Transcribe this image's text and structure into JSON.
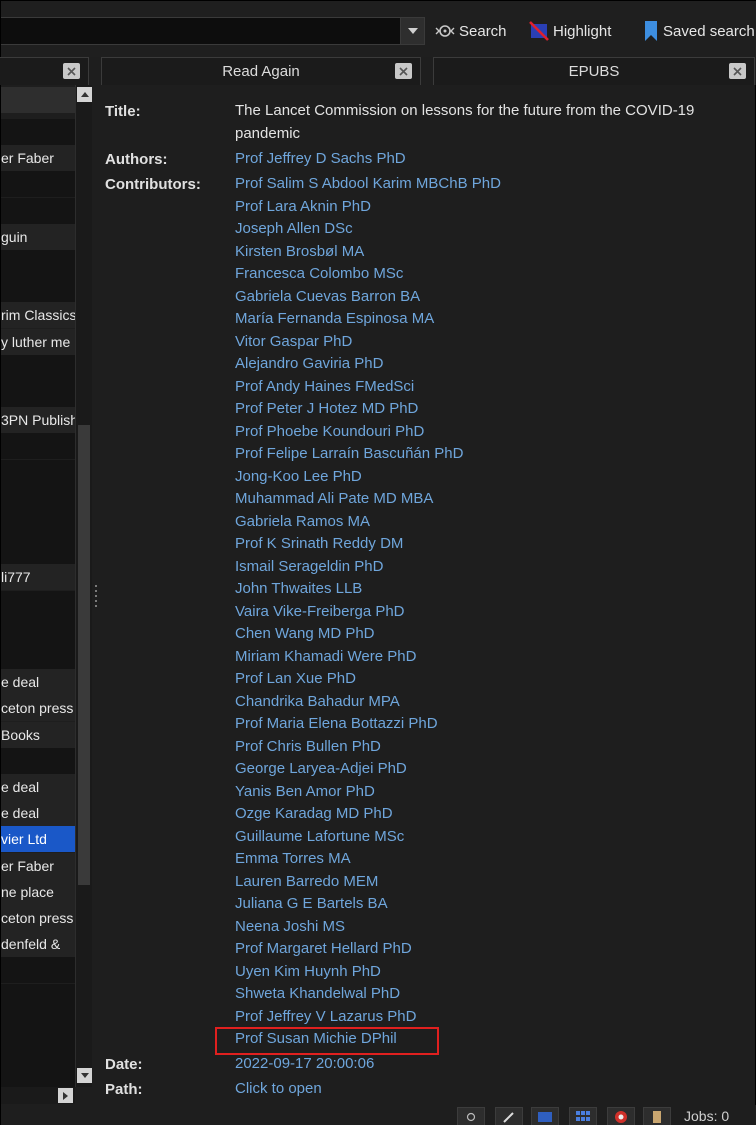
{
  "toolbar": {
    "search_label": "Search",
    "highlight_label": "Highlight",
    "saved_search_label": "Saved search"
  },
  "tabs": [
    {
      "label": ""
    },
    {
      "label": "Read Again"
    },
    {
      "label": "EPUBS"
    }
  ],
  "left_list": {
    "rows": [
      {
        "text": "",
        "style": "dark"
      },
      {
        "text": "er  Faber",
        "style": "mid"
      },
      {
        "text": "",
        "style": "dark"
      },
      {
        "text": "",
        "style": "dark"
      },
      {
        "text": "guin",
        "style": "mid"
      },
      {
        "text": "",
        "style": "dark"
      },
      {
        "text": "",
        "style": "dark"
      },
      {
        "text": "rim Classics",
        "style": "mid"
      },
      {
        "text": "y luther me",
        "style": "mid"
      },
      {
        "text": "",
        "style": "dark"
      },
      {
        "text": "",
        "style": "dark"
      },
      {
        "text": "3PN Publish",
        "style": "mid"
      },
      {
        "text": "",
        "style": "dark"
      },
      {
        "text": "",
        "style": "dark"
      },
      {
        "text": "",
        "style": "dark"
      },
      {
        "text": "",
        "style": "dark"
      },
      {
        "text": "",
        "style": "dark"
      },
      {
        "text": "li777",
        "style": "mid"
      },
      {
        "text": "",
        "style": "dark"
      },
      {
        "text": "",
        "style": "dark"
      },
      {
        "text": "",
        "style": "dark"
      },
      {
        "text": "e deal",
        "style": "mid"
      },
      {
        "text": "ceton press",
        "style": "mid"
      },
      {
        "text": "Books",
        "style": "mid"
      },
      {
        "text": "",
        "style": "dark"
      },
      {
        "text": "e deal",
        "style": "mid"
      },
      {
        "text": "e deal",
        "style": "mid"
      },
      {
        "text": "vier Ltd",
        "style": "sel"
      },
      {
        "text": "er  Faber",
        "style": "mid"
      },
      {
        "text": "ne place",
        "style": "mid"
      },
      {
        "text": "ceton press",
        "style": "mid"
      },
      {
        "text": "denfeld &",
        "style": "mid"
      },
      {
        "text": "",
        "style": "dark"
      },
      {
        "text": "",
        "style": "dark"
      },
      {
        "text": "",
        "style": "dark"
      },
      {
        "text": "",
        "style": "dark"
      },
      {
        "text": "",
        "style": "dark"
      }
    ]
  },
  "details": {
    "title_label": "Title:",
    "title_value": "The Lancet Commission on lessons for the future from the COVID-19 pandemic",
    "authors_label": "Authors:",
    "author_value": "Prof Jeffrey D Sachs PhD",
    "contributors_label": "Contributors:",
    "contributors": [
      "Prof Salim S Abdool Karim MBChB PhD",
      "Prof Lara Aknin PhD",
      "Joseph Allen DSc",
      "Kirsten Brosbøl MA",
      "Francesca Colombo MSc",
      "Gabriela Cuevas Barron BA",
      "María Fernanda Espinosa MA",
      "Vitor Gaspar PhD",
      "Alejandro Gaviria PhD",
      "Prof Andy Haines FMedSci",
      "Prof Peter J Hotez MD PhD",
      "Prof Phoebe Koundouri PhD",
      "Prof Felipe Larraín Bascuñán PhD",
      "Jong-Koo Lee PhD",
      "Muhammad Ali Pate MD MBA",
      "Gabriela Ramos MA",
      "Prof K Srinath Reddy DM",
      "Ismail Serageldin PhD",
      "John Thwaites LLB",
      "Vaira Vike-Freiberga PhD",
      "Chen Wang MD PhD",
      "Miriam Khamadi Were PhD",
      "Prof Lan Xue PhD",
      "Chandrika Bahadur MPA",
      "Prof Maria Elena Bottazzi PhD",
      "Prof Chris Bullen PhD",
      "George Laryea-Adjei PhD",
      "Yanis Ben Amor PhD",
      "Ozge Karadag MD PhD",
      "Guillaume Lafortune MSc",
      "Emma Torres MA",
      "Lauren Barredo MEM",
      "Juliana G E Bartels BA",
      "Neena Joshi MS",
      "Prof Margaret Hellard PhD",
      "Uyen Kim Huynh PhD",
      "Shweta Khandelwal PhD",
      "Prof Jeffrey V Lazarus PhD",
      "Prof Susan Michie DPhil"
    ],
    "date_label": "Date:",
    "date_value": "2022-09-17 20:00:06",
    "path_label": "Path:",
    "path_value": "Click to open"
  },
  "statusbar": {
    "jobs_label": "Jobs: 0"
  },
  "colors": {
    "link": "#6fa6dc",
    "selection": "#1a58c8",
    "highlight_box": "#e0201f"
  }
}
